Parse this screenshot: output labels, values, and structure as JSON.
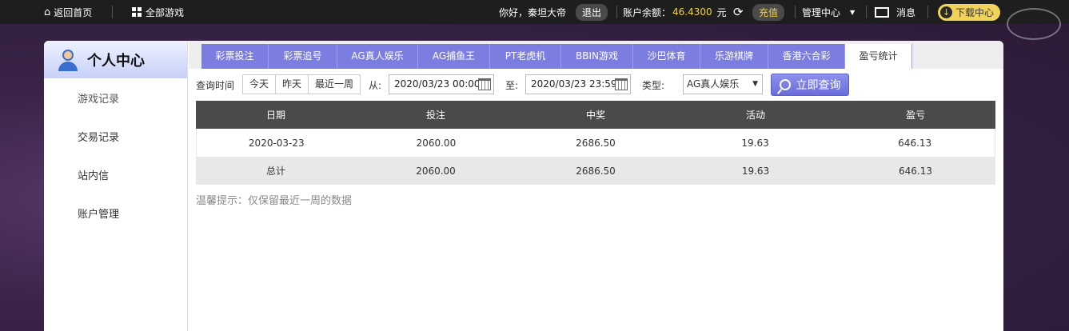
{
  "topbar": {
    "home": "返回首页",
    "all_games": "全部游戏",
    "greeting": "你好，秦坦大帝",
    "logout": "退出",
    "balance_label": "账户余额：",
    "balance_value": "46.4300",
    "currency": "元",
    "recharge": "充值",
    "manage": "管理中心",
    "messages": "消息",
    "download": "下载中心"
  },
  "sidebar": {
    "title": "个人中心",
    "items": [
      {
        "label": "游戏记录"
      },
      {
        "label": "交易记录"
      },
      {
        "label": "站内信"
      },
      {
        "label": "账户管理"
      }
    ]
  },
  "tabs": [
    {
      "label": "彩票投注"
    },
    {
      "label": "彩票追号"
    },
    {
      "label": "AG真人娱乐"
    },
    {
      "label": "AG捕鱼王"
    },
    {
      "label": "PT老虎机"
    },
    {
      "label": "BBIN游戏"
    },
    {
      "label": "沙巴体育"
    },
    {
      "label": "乐游棋牌"
    },
    {
      "label": "香港六合彩"
    },
    {
      "label": "盈亏统计"
    }
  ],
  "query": {
    "label": "查询时间",
    "today": "今天",
    "yesterday": "昨天",
    "last_week": "最近一周",
    "from_label": "从:",
    "from_value": "2020/03/23 00:00",
    "to_label": "至:",
    "to_value": "2020/03/23 23:59",
    "type_label": "类型:",
    "type_value": "AG真人娱乐",
    "submit": "立即查询"
  },
  "table": {
    "headers": [
      "日期",
      "投注",
      "中奖",
      "活动",
      "盈亏"
    ],
    "rows": [
      [
        "2020-03-23",
        "2060.00",
        "2686.50",
        "19.63",
        "646.13"
      ]
    ],
    "total": [
      "总计",
      "2060.00",
      "2686.50",
      "19.63",
      "646.13"
    ]
  },
  "tip": "温馨提示：仅保留最近一周的数据"
}
